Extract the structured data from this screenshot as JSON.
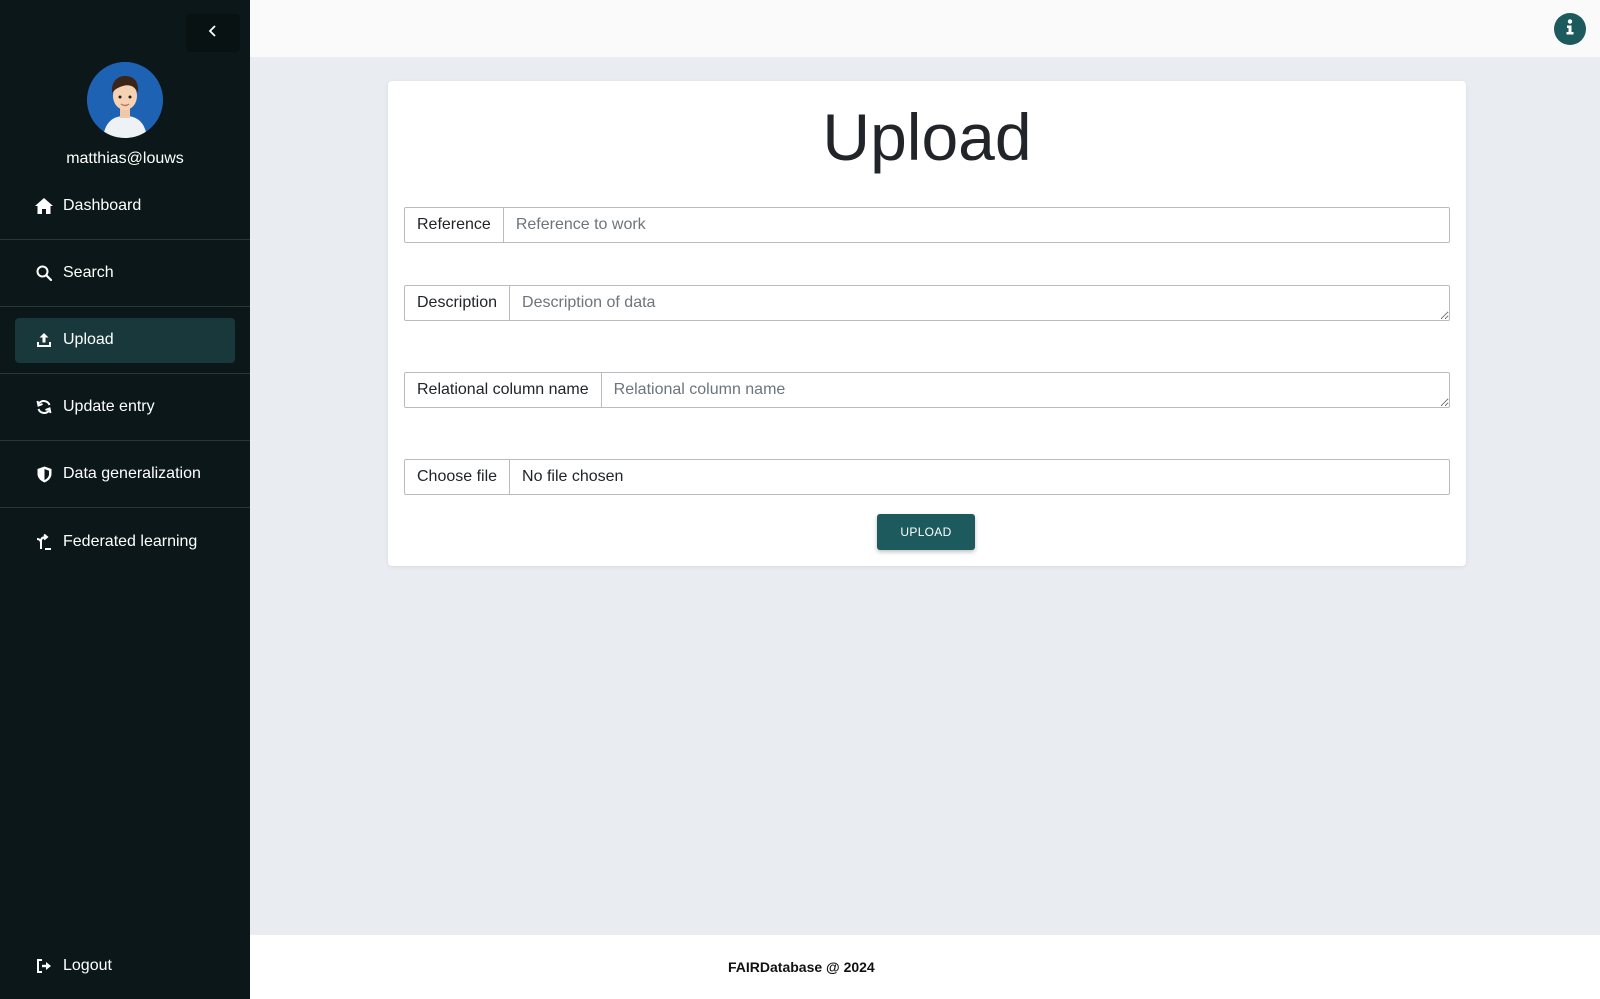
{
  "sidebar": {
    "collapse_icon": "chevron-left-icon",
    "user": {
      "username": "matthias@louws"
    },
    "items": [
      {
        "label": "Dashboard",
        "icon": "home-icon"
      },
      {
        "label": "Search",
        "icon": "search-icon"
      },
      {
        "label": "Upload",
        "icon": "upload-icon",
        "active": true
      },
      {
        "label": "Update entry",
        "icon": "refresh-icon"
      },
      {
        "label": "Data generalization",
        "icon": "shield-icon"
      },
      {
        "label": "Federated learning",
        "icon": "branch-icon"
      }
    ],
    "logout_label": "Logout"
  },
  "topbar": {
    "info_icon": "info-icon"
  },
  "main": {
    "title": "Upload",
    "reference": {
      "label": "Reference",
      "placeholder": "Reference to work"
    },
    "description": {
      "label": "Description",
      "placeholder": "Description of data"
    },
    "relational": {
      "label": "Relational column name",
      "placeholder": "Relational column name"
    },
    "file": {
      "button_label": "Choose file",
      "status": "No file chosen"
    },
    "submit_label": "UPLOAD"
  },
  "footer": {
    "text": "FAIRDatabase @ 2024"
  },
  "colors": {
    "sidebar_bg": "#0b1718",
    "active_bg": "#18383c",
    "accent": "#1d5a5e",
    "page_bg": "#e9ecf1"
  }
}
